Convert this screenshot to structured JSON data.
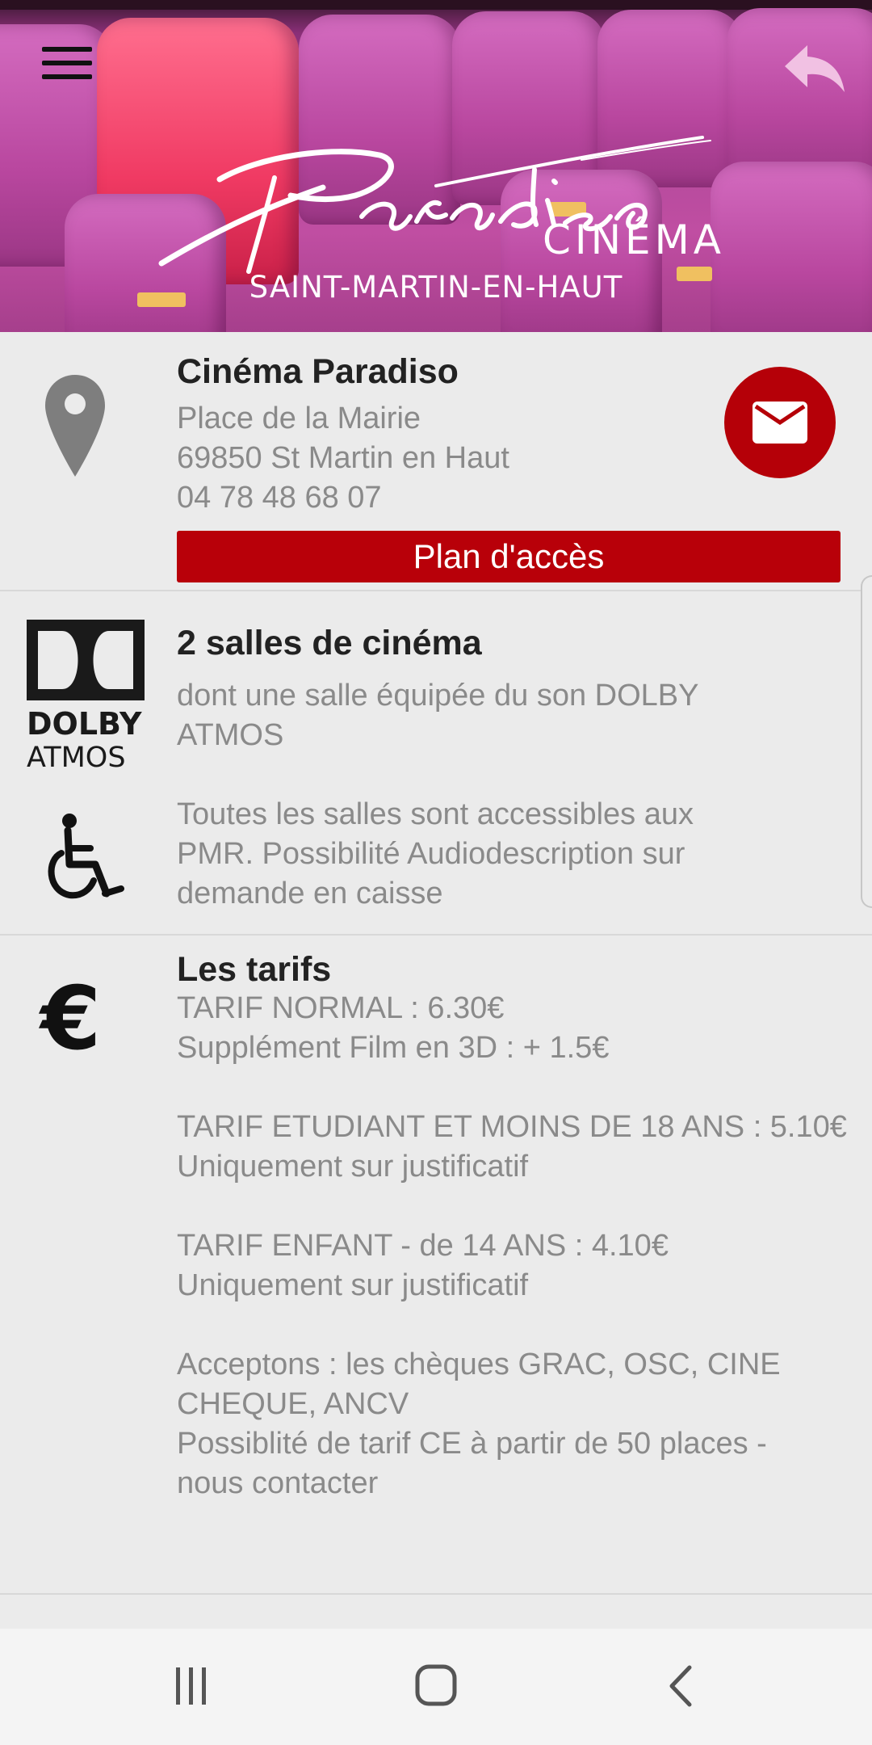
{
  "header": {
    "logo_script": "Paradiso",
    "logo_word": "CINÉMA",
    "logo_town": "SAINT-MARTIN-EN-HAUT",
    "menu_icon": "hamburger-menu-icon",
    "back_icon": "reply-arrow-icon"
  },
  "contact": {
    "name": "Cinéma Paradiso",
    "address_line1": "Place de la Mairie",
    "address_line2": "69850 St Martin en Haut",
    "phone": "04 78 48 68 07",
    "map_button": "Plan d'accès",
    "icon": "map-pin-icon",
    "mail_icon": "mail-icon"
  },
  "rooms": {
    "title": "2 salles de cinéma",
    "desc_line1": "dont une salle équipée du son DOLBY",
    "desc_line2": "ATMOS",
    "dolby_word": "DOLBY",
    "atmos_word": "ATMOS",
    "access_line1": "Toutes les salles sont accessibles aux",
    "access_line2": "PMR. Possibilité Audiodescription sur",
    "access_line3": "demande en caisse"
  },
  "tarifs": {
    "title": "Les tarifs",
    "icon_symbol": "€",
    "lines": [
      "TARIF NORMAL : 6.30€",
      "Supplément Film en 3D : + 1.5€",
      "TARIF ETUDIANT ET MOINS DE 18 ANS : 5.10€",
      "Uniquement sur justificatif",
      "TARIF ENFANT - de 14 ANS : 4.10€",
      "Uniquement sur justificatif",
      "Acceptons : les chèques GRAC, OSC, CINE",
      "CHEQUE, ANCV",
      "Possiblité de tarif CE à partir de 50 places -",
      "nous contacter"
    ]
  },
  "colors": {
    "accent_red": "#b80009",
    "background": "#ebebeb",
    "text_gray": "#8a8a8a"
  },
  "navbar": {
    "recents_icon": "recent-apps-icon",
    "home_icon": "home-icon",
    "back_icon": "back-chevron-icon"
  }
}
